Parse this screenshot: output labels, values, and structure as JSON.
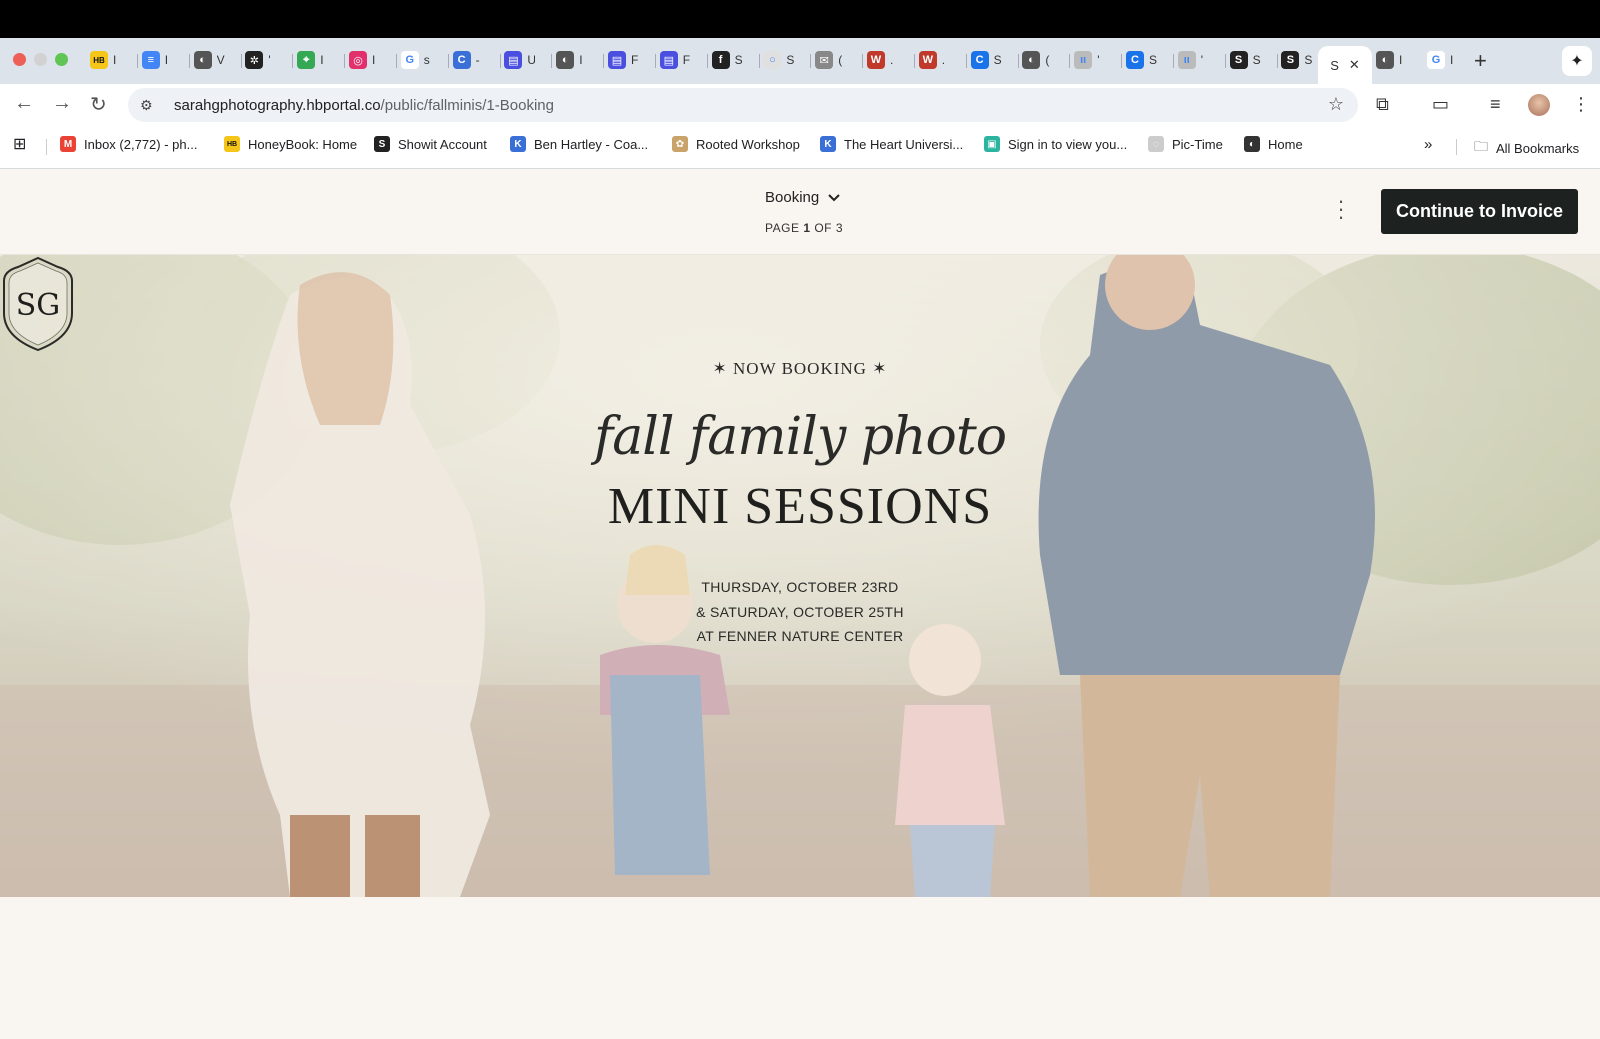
{
  "browser": {
    "tabs": [
      {
        "icon": "honeybook-icon",
        "label": "I",
        "bg": "#f5c518",
        "glyph": "HB"
      },
      {
        "icon": "docs-icon",
        "label": "I",
        "bg": "#4285f4",
        "glyph": "≡"
      },
      {
        "icon": "globe-icon",
        "label": "V",
        "bg": "#555",
        "glyph": "◐"
      },
      {
        "icon": "openai-icon",
        "label": "'",
        "bg": "#222",
        "glyph": "✲"
      },
      {
        "icon": "maps-icon",
        "label": "I",
        "bg": "#34a853",
        "glyph": "⌖"
      },
      {
        "icon": "instagram-icon",
        "label": "I",
        "bg": "#e1306c",
        "glyph": "◎"
      },
      {
        "icon": "google-icon",
        "label": "s",
        "bg": "#fff",
        "glyph": "G"
      },
      {
        "icon": "c-icon",
        "label": "-",
        "bg": "#3b6fd8",
        "glyph": "C"
      },
      {
        "icon": "printer-icon",
        "label": "U",
        "bg": "#4a4fe0",
        "glyph": "▤"
      },
      {
        "icon": "globe-icon",
        "label": "I",
        "bg": "#555",
        "glyph": "◐"
      },
      {
        "icon": "printer-icon",
        "label": "F",
        "bg": "#4a4fe0",
        "glyph": "▤"
      },
      {
        "icon": "printer-icon",
        "label": "F",
        "bg": "#4a4fe0",
        "glyph": "▤"
      },
      {
        "icon": "facebook-icon",
        "label": "S",
        "bg": "#222",
        "glyph": "f"
      },
      {
        "icon": "circle-icon",
        "label": "S",
        "bg": "#e0e0e0",
        "glyph": "○"
      },
      {
        "icon": "mail-icon",
        "label": "(",
        "bg": "#888",
        "glyph": "✉"
      },
      {
        "icon": "w-icon",
        "label": ".",
        "bg": "#c0392b",
        "glyph": "W"
      },
      {
        "icon": "w-icon",
        "label": ".",
        "bg": "#c0392b",
        "glyph": "W"
      },
      {
        "icon": "c-icon",
        "label": "S",
        "bg": "#1a73e8",
        "glyph": "C"
      },
      {
        "icon": "globe-icon",
        "label": "(",
        "bg": "#555",
        "glyph": "◐"
      },
      {
        "icon": "ll-icon",
        "label": "'",
        "bg": "#bbb",
        "glyph": "ιι"
      },
      {
        "icon": "c-icon",
        "label": "S",
        "bg": "#1a73e8",
        "glyph": "C"
      },
      {
        "icon": "ll-icon",
        "label": "'",
        "bg": "#bbb",
        "glyph": "ιι"
      },
      {
        "icon": "showit-icon",
        "label": "S",
        "bg": "#222",
        "glyph": "S"
      },
      {
        "icon": "showit-icon",
        "label": "S",
        "bg": "#222",
        "glyph": "S"
      }
    ],
    "active_tab": {
      "label": "S"
    },
    "after_tabs": [
      {
        "icon": "globe-icon",
        "label": "I",
        "bg": "#555",
        "glyph": "◐"
      },
      {
        "icon": "google-icon",
        "label": "I",
        "bg": "#fff",
        "glyph": "G"
      }
    ],
    "url_host": "sarahgphotography.hbportal.co",
    "url_path": "/public/fallminis/1-Booking",
    "bookmarks": [
      {
        "label": "Inbox (2,772) - ph...",
        "icon": "gmail-icon",
        "bg": "#ea4335",
        "glyph": "M"
      },
      {
        "label": "HoneyBook: Home",
        "icon": "honeybook-icon",
        "bg": "#f5c518",
        "glyph": "HB"
      },
      {
        "label": "Showit Account",
        "icon": "showit-icon",
        "bg": "#222",
        "glyph": "S"
      },
      {
        "label": "Ben Hartley - Coa...",
        "icon": "kajabi-icon",
        "bg": "#3b6fd8",
        "glyph": "K"
      },
      {
        "label": "Rooted Workshop",
        "icon": "rooted-icon",
        "bg": "#c9a36a",
        "glyph": "✿"
      },
      {
        "label": "The Heart Universi...",
        "icon": "kajabi-icon",
        "bg": "#3b6fd8",
        "glyph": "K"
      },
      {
        "label": "Sign in to view you...",
        "icon": "signin-icon",
        "bg": "#2bb5a0",
        "glyph": "▣"
      },
      {
        "label": "Pic-Time",
        "icon": "pictime-icon",
        "bg": "#ccc",
        "glyph": "◌"
      },
      {
        "label": "Home",
        "icon": "globe-icon",
        "bg": "#333",
        "glyph": "◐"
      }
    ],
    "all_bookmarks": "All Bookmarks"
  },
  "app": {
    "booking_label": "Booking",
    "page_prefix": "PAGE",
    "page_current": "1",
    "page_suffix": "OF 3",
    "cta_label": "Continue to Invoice"
  },
  "hero": {
    "now_booking": "✶  NOW BOOKING  ✶",
    "script_title": "fall family photo",
    "main_title": "MINI SESSIONS",
    "date_line_1": "THURSDAY, OCTOBER 23RD",
    "date_line_2": "& SATURDAY, OCTOBER 25TH",
    "date_line_3": "AT FENNER NATURE CENTER",
    "crest_letters": "SG"
  },
  "colors": {
    "cta_bg": "#1d211f",
    "page_bg": "#f9f6f1"
  }
}
